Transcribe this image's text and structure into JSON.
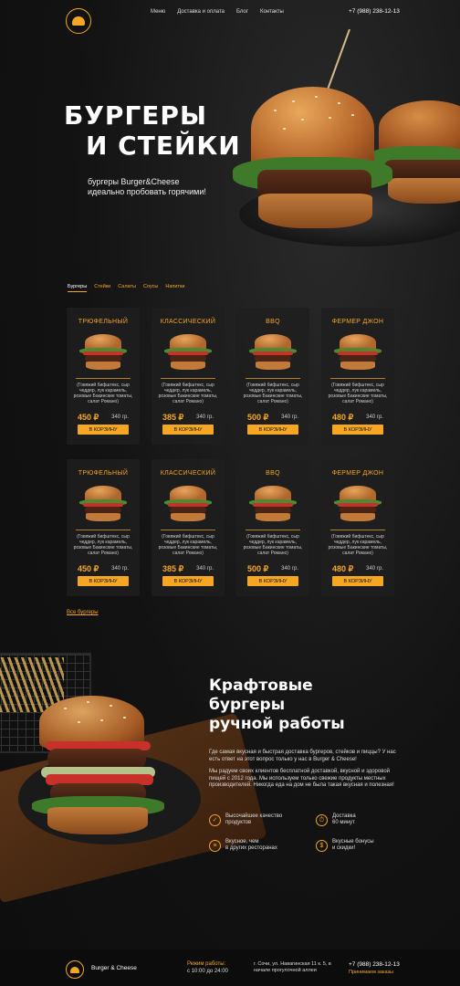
{
  "header": {
    "nav": [
      "Меню",
      "Доставка и оплата",
      "Блог",
      "Контакты"
    ],
    "phone": "+7 (988) 238-12-13"
  },
  "hero": {
    "title_line1": "БУРГЕРЫ",
    "title_line2": "И СТЕЙКИ",
    "subtitle_line1": "бургеры Burger&Cheese",
    "subtitle_line2": "идеально пробовать горячими!"
  },
  "tabs": [
    "Бургеры",
    "Стейки",
    "Салаты",
    "Соусы",
    "Напитки"
  ],
  "products": [
    {
      "name": "ТРЮФЕЛЬНЫЙ",
      "desc": "(Говяжий бифштекс, сыр чеддер, лук карамель, розовые Бакинские томаты, салат Романо)",
      "price": "450 ₽",
      "weight": "340 гр.",
      "button": "В КОРЗИНУ"
    },
    {
      "name": "КЛАССИЧЕСКИЙ",
      "desc": "(Говяжий бифштекс, сыр чеддер, лук карамель, розовые Бакинские томаты, салат Романо)",
      "price": "385 ₽",
      "weight": "340 гр.",
      "button": "В КОРЗИНУ"
    },
    {
      "name": "BBQ",
      "desc": "(Говяжий бифштекс, сыр чеддер, лук карамель, розовые Бакинские томаты, салат Романо)",
      "price": "500 ₽",
      "weight": "340 гр.",
      "button": "В КОРЗИНУ"
    },
    {
      "name": "ФЕРМЕР ДЖОН",
      "desc": "(Говяжий бифштекс, сыр чеддер, лук карамель, розовые Бакинские томаты, салат Романо)",
      "price": "480 ₽",
      "weight": "340 гр.",
      "button": "В КОРЗИНУ"
    },
    {
      "name": "ТРЮФЕЛЬНЫЙ",
      "desc": "(Говяжий бифштекс, сыр чеддер, лук карамель, розовые Бакинские томаты, салат Романо)",
      "price": "450 ₽",
      "weight": "340 гр.",
      "button": "В КОРЗИНУ"
    },
    {
      "name": "КЛАССИЧЕСКИЙ",
      "desc": "(Говяжий бифштекс, сыр чеддер, лук карамель, розовые Бакинские томаты, салат Романо)",
      "price": "385 ₽",
      "weight": "340 гр.",
      "button": "В КОРЗИНУ"
    },
    {
      "name": "BBQ",
      "desc": "(Говяжий бифштекс, сыр чеддер, лук карамель, розовые Бакинские томаты, салат Романо)",
      "price": "500 ₽",
      "weight": "340 гр.",
      "button": "В КОРЗИНУ"
    },
    {
      "name": "ФЕРМЕР ДЖОН",
      "desc": "(Говяжий бифштекс, сыр чеддер, лук карамель, розовые Бакинские томаты, салат Романо)",
      "price": "480 ₽",
      "weight": "340 гр.",
      "button": "В КОРЗИНУ"
    }
  ],
  "all_link": "Все бургеры",
  "craft": {
    "title_line1": "Крафтовые",
    "title_line2": "бургеры",
    "title_line3": "ручной работы",
    "question": "Где самая вкусная и быстрая доставка бургеров, стейков и пиццы? У нас есть ответ на этот вопрос только у нас в Burger & Cheese!",
    "paragraph": "Мы радуем своих клиентов бесплатной доставкой, вкусной и здоровой пищей с 2012 года. Мы используем только свежие продукты местных производителей. Никогда еда на дом не была такая вкусная и полезная!",
    "features": [
      {
        "icon": "quality-icon",
        "line1": "Высочайшее качество",
        "line2": "продуктов"
      },
      {
        "icon": "delivery-icon",
        "line1": "Доставка",
        "line2": "60 минут"
      },
      {
        "icon": "burger-icon",
        "line1": "Вкусное, чем",
        "line2": "в других ресторанах"
      },
      {
        "icon": "piggy-bank-icon",
        "line1": "Вкусные бонусы",
        "line2": "и скидки!"
      }
    ]
  },
  "footer": {
    "brand": "Burger & Cheese",
    "hours_label": "Режим работы:",
    "hours": "с 10:00 до 24:00",
    "address": "г. Сочи, ул. Навагинская 11 к. 5, в начале прогулочной аллеи",
    "phone": "+7 (988) 238-12-13",
    "orders": "Принимаем заказы"
  },
  "colors": {
    "accent": "#f5a623",
    "background": "#141414"
  }
}
